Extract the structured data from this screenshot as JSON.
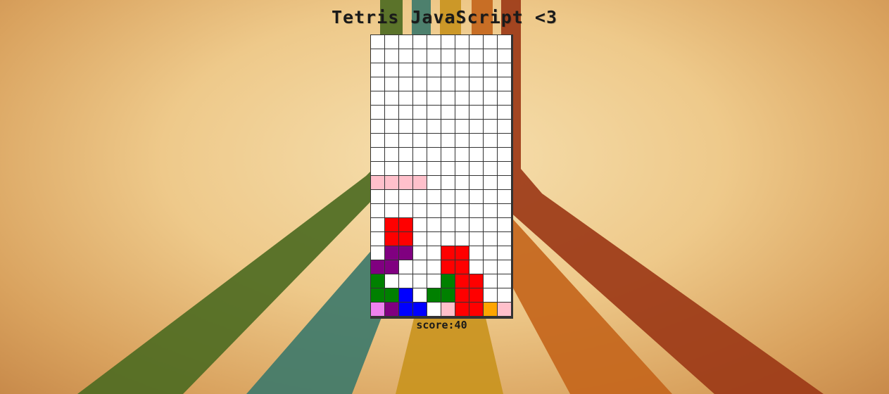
{
  "page": {
    "title": "Tetris JavaScript <3"
  },
  "score": {
    "text": "score:40"
  },
  "board": {
    "columns": 10,
    "rows": 20,
    "empty_color": "#ffffff",
    "grid_color": "#333333",
    "colors": {
      "P": "#ffc0cb",
      "R": "#ff0000",
      "U": "#800080",
      "G": "#008000",
      "B": "#0000ff",
      "V": "#ee82ee",
      "O": "#ffa500"
    },
    "grid": [
      "..........",
      "..........",
      "..........",
      "..........",
      "..........",
      "..........",
      "..........",
      "..........",
      "..........",
      "..........",
      "PPPP......",
      "..........",
      "..........",
      ".RR.......",
      ".RR.......",
      ".UU..RR...",
      "UU...RR...",
      "G....GRR..",
      "GGB.GGRR..",
      "VUBB.PRROP"
    ]
  },
  "background": {
    "stripe_colors": [
      "#4e6b22",
      "#3f7a6a",
      "#c99420",
      "#c4661c",
      "#9c3a17"
    ]
  }
}
